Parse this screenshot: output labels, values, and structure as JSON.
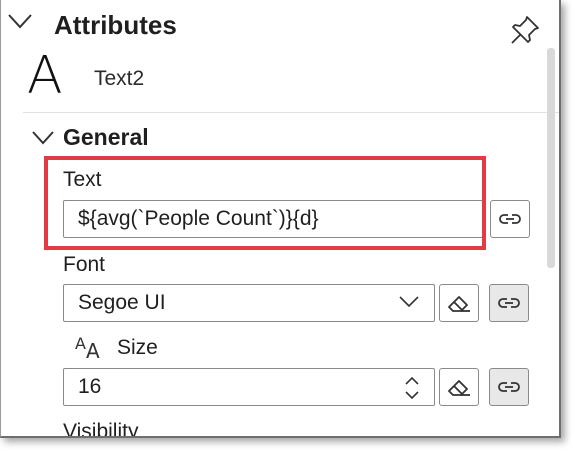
{
  "panel": {
    "title": "Attributes",
    "element_icon_glyph": "A",
    "element_name": "Text2"
  },
  "general": {
    "section_title": "General",
    "text_label": "Text",
    "text_value": "${avg(`People Count`)}{d}",
    "font_label": "Font",
    "font_value": "Segoe UI",
    "size_label": "Size",
    "size_value": "16",
    "visibility_label": "Visibility"
  },
  "icons": {
    "header_chevron": "chevron-down-icon",
    "pin": "pin-icon",
    "link": "link-icon",
    "eraser": "eraser-icon",
    "font_size": "font-size-icon",
    "spinner": "spinner-arrows-icon"
  },
  "colors": {
    "highlight": "#e23b43",
    "text": "#1f1f1f",
    "bound_button_bg": "#e8e8e8"
  }
}
